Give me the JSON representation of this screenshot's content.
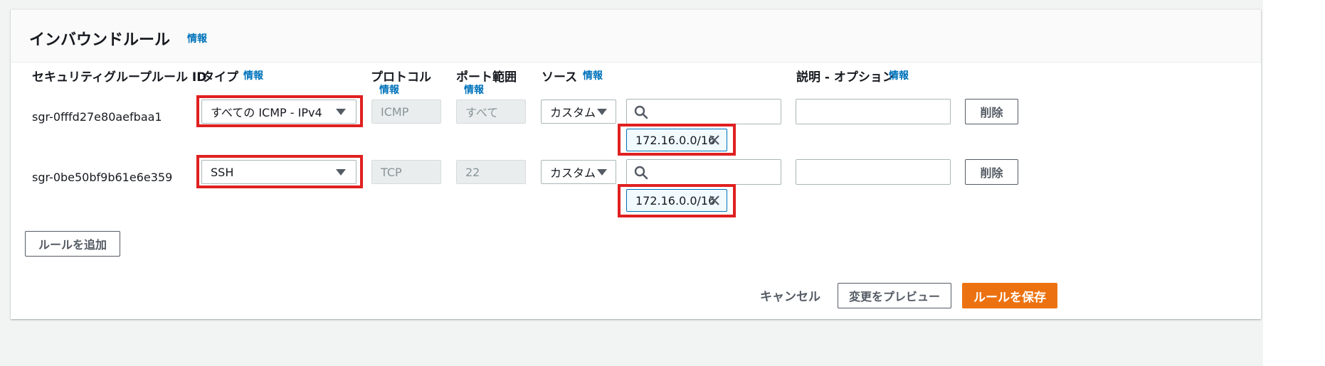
{
  "panel": {
    "title": "インバウンドルール",
    "info": "情報"
  },
  "columns": {
    "rule_id": "セキュリティグループルール ID",
    "type": "タイプ",
    "type_info": "情報",
    "protocol": "プロトコル",
    "protocol_info": "情報",
    "port_range": "ポート範囲",
    "port_range_info": "情報",
    "source": "ソース",
    "source_info": "情報",
    "description": "説明 - オプション",
    "description_info": "情報"
  },
  "rules": [
    {
      "id": "sgr-0fffd27e80aefbaa1",
      "type": "すべての ICMP - IPv4",
      "protocol": "ICMP",
      "port_range": "すべて",
      "source_type": "カスタム",
      "search_value": "",
      "cidr": "172.16.0.0/16",
      "description": "",
      "delete_label": "削除"
    },
    {
      "id": "sgr-0be50bf9b61e6e359",
      "type": "SSH",
      "protocol": "TCP",
      "port_range": "22",
      "source_type": "カスタム",
      "search_value": "",
      "cidr": "172.16.0.0/16",
      "description": "",
      "delete_label": "削除"
    }
  ],
  "add_rule_label": "ルールを追加",
  "footer": {
    "cancel_label": "キャンセル",
    "preview_label": "変更をプレビュー",
    "save_label": "ルールを保存"
  },
  "colors": {
    "accent": "#ec7211",
    "link": "#0073bb",
    "highlight": "#e02020",
    "token_bg": "#f1faff"
  },
  "icons": {
    "search": "search-icon",
    "remove": "close-icon",
    "dropdown": "caret-down-icon"
  }
}
